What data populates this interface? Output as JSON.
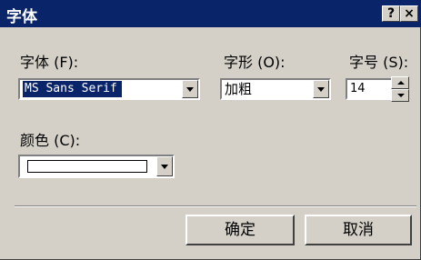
{
  "window": {
    "title": "字体"
  },
  "titlebar": {
    "help_label": "?",
    "close_label": "×"
  },
  "font": {
    "label": "字体 (F):",
    "value": "MS Sans Serif"
  },
  "style": {
    "label": "字形 (O):",
    "value": "加粗"
  },
  "size": {
    "label": "字号 (S):",
    "value": "14"
  },
  "color": {
    "label": "颜色 (C):",
    "value": "#ffffff"
  },
  "buttons": {
    "ok": "确定",
    "cancel": "取消"
  }
}
